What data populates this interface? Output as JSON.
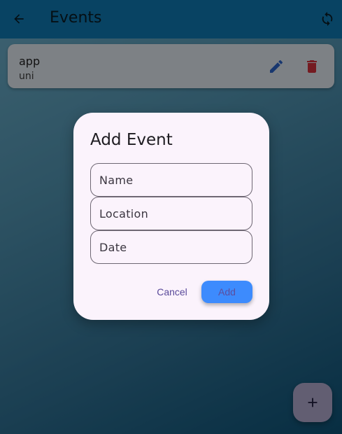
{
  "appbar": {
    "title": "Events",
    "back_icon": "arrow-back-icon",
    "refresh_icon": "refresh-icon"
  },
  "events": [
    {
      "name": "app",
      "location": "uni"
    }
  ],
  "dialog": {
    "title": "Add Event",
    "name_placeholder": "Name",
    "location_placeholder": "Location",
    "date_placeholder": "Date",
    "cancel_label": "Cancel",
    "add_label": "Add"
  },
  "fab": {
    "icon": "plus-icon"
  },
  "colors": {
    "appbar": "#0f74ab",
    "edit": "#2a5fbf",
    "delete": "#c8303a",
    "dialog_bg": "#fbf3fc",
    "add_button": "#3d8bfd"
  }
}
